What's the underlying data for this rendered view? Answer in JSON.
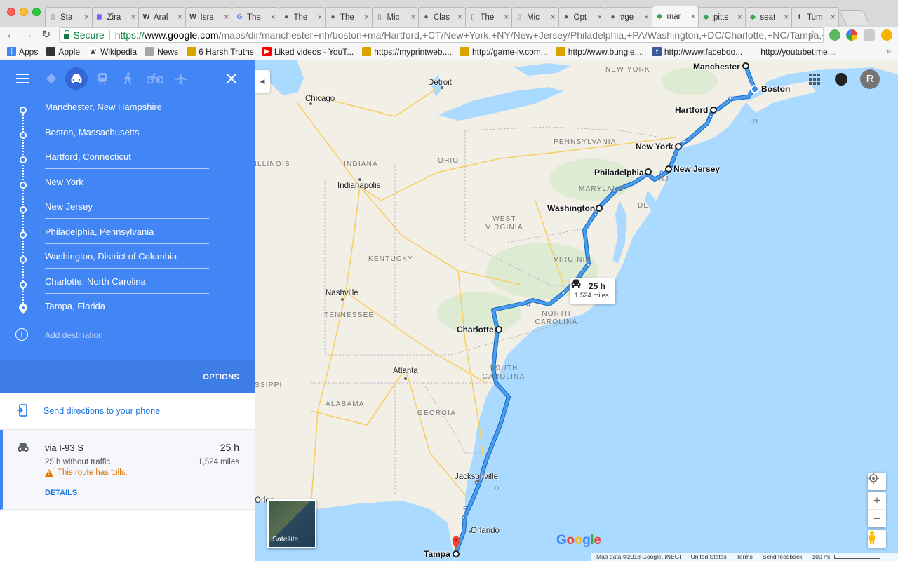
{
  "browser": {
    "tabs": [
      {
        "title": "Sta",
        "icon": "doc-icon"
      },
      {
        "title": "Zira",
        "icon": "zira-icon"
      },
      {
        "title": "Aral",
        "icon": "wikipedia-icon"
      },
      {
        "title": "Isra",
        "icon": "wikipedia-icon"
      },
      {
        "title": "The",
        "icon": "google-icon"
      },
      {
        "title": "The",
        "icon": "site-icon"
      },
      {
        "title": "The",
        "icon": "site-icon"
      },
      {
        "title": "Mic",
        "icon": "doc-icon"
      },
      {
        "title": "Clas",
        "icon": "site-icon"
      },
      {
        "title": "The",
        "icon": "doc-icon"
      },
      {
        "title": "Mic",
        "icon": "doc-icon"
      },
      {
        "title": "Opt",
        "icon": "site-icon"
      },
      {
        "title": "#ge",
        "icon": "site-icon"
      },
      {
        "title": "mar",
        "icon": "maps-icon"
      },
      {
        "title": "pitts",
        "icon": "maps-icon"
      },
      {
        "title": "seat",
        "icon": "maps-icon"
      },
      {
        "title": "Tum",
        "icon": "tumblr-icon"
      }
    ],
    "active_tab_index": 13,
    "close_glyph": "×",
    "address": {
      "secure_label": "Secure",
      "scheme": "https://",
      "host": "www.google.com",
      "path": "/maps/dir/manchester+nh/boston+ma/Hartford,+CT/New+York,+NY/New+Jersey/Philadelphia,+PA/Washington,+DC/Charlotte,+NC/Tampa,+FL/@3..."
    },
    "bookmarks": [
      {
        "label": "Apps",
        "icon": "apps-grid-icon"
      },
      {
        "label": "Apple",
        "icon": "apple-icon"
      },
      {
        "label": "Wikipedia",
        "icon": "wikipedia-icon"
      },
      {
        "label": "News",
        "icon": "folder-icon"
      },
      {
        "label": "6 Harsh Truths",
        "icon": "site-icon"
      },
      {
        "label": "Liked videos - YouT...",
        "icon": "youtube-icon"
      },
      {
        "label": "https://myprintweb....",
        "icon": "site-icon"
      },
      {
        "label": "http://game-iv.com...",
        "icon": "site-icon"
      },
      {
        "label": "http://www.bungie....",
        "icon": "site-icon"
      },
      {
        "label": "http://www.faceboo...",
        "icon": "facebook-icon"
      },
      {
        "label": "http://youtubetime....",
        "icon": ""
      }
    ],
    "bookmarks_more": "»"
  },
  "panel": {
    "waypoints": [
      "Manchester, New Hampshire",
      "Boston, Massachusetts",
      "Hartford, Connecticut",
      "New York",
      "New Jersey",
      "Philadelphia, Pennsylvania",
      "Washington, District of Columbia",
      "Charlotte, North Carolina",
      "Tampa, Florida"
    ],
    "add_destination": "Add destination",
    "options_label": "OPTIONS",
    "send_directions": "Send directions to your phone",
    "route": {
      "via": "via I-93 S",
      "time": "25 h",
      "without_traffic": "25 h without traffic",
      "miles": "1,524 miles",
      "warning": "This route has tolls.",
      "details": "DETAILS"
    }
  },
  "map": {
    "states": [
      "NEW YORK",
      "PENNSYLVANIA",
      "OHIO",
      "ILLINOIS",
      "INDIANA",
      "MARYLAND",
      "NJ",
      "DE",
      "RI",
      "WEST VIRGINIA",
      "VIRGINIA",
      "KENTUCKY",
      "TENNESSEE",
      "NORTH CAROLINA",
      "SOUTH CAROLINA",
      "GEORGIA",
      "ALABAMA",
      "SSIPPI"
    ],
    "cities": [
      "Detroit",
      "Chicago",
      "Indianapolis",
      "Nashville",
      "Atlanta",
      "Jacksonville",
      "Orlando",
      "Orlea"
    ],
    "stops": [
      "Manchester",
      "Boston",
      "Hartford",
      "New York",
      "Philadelphia",
      "New Jersey",
      "Washington",
      "Charlotte",
      "Tampa"
    ],
    "eta": {
      "time": "25 h",
      "miles": "1,524 miles"
    },
    "satellite_label": "Satellite",
    "logo": "Google",
    "footer": [
      "Map data ©2018 Google, INEGI",
      "United States",
      "Terms",
      "Send feedback",
      "100 mi"
    ],
    "avatar_letter": "R",
    "colors": {
      "route": "#4a9ded",
      "panel": "#4285f4",
      "water": "#aadaff"
    }
  }
}
